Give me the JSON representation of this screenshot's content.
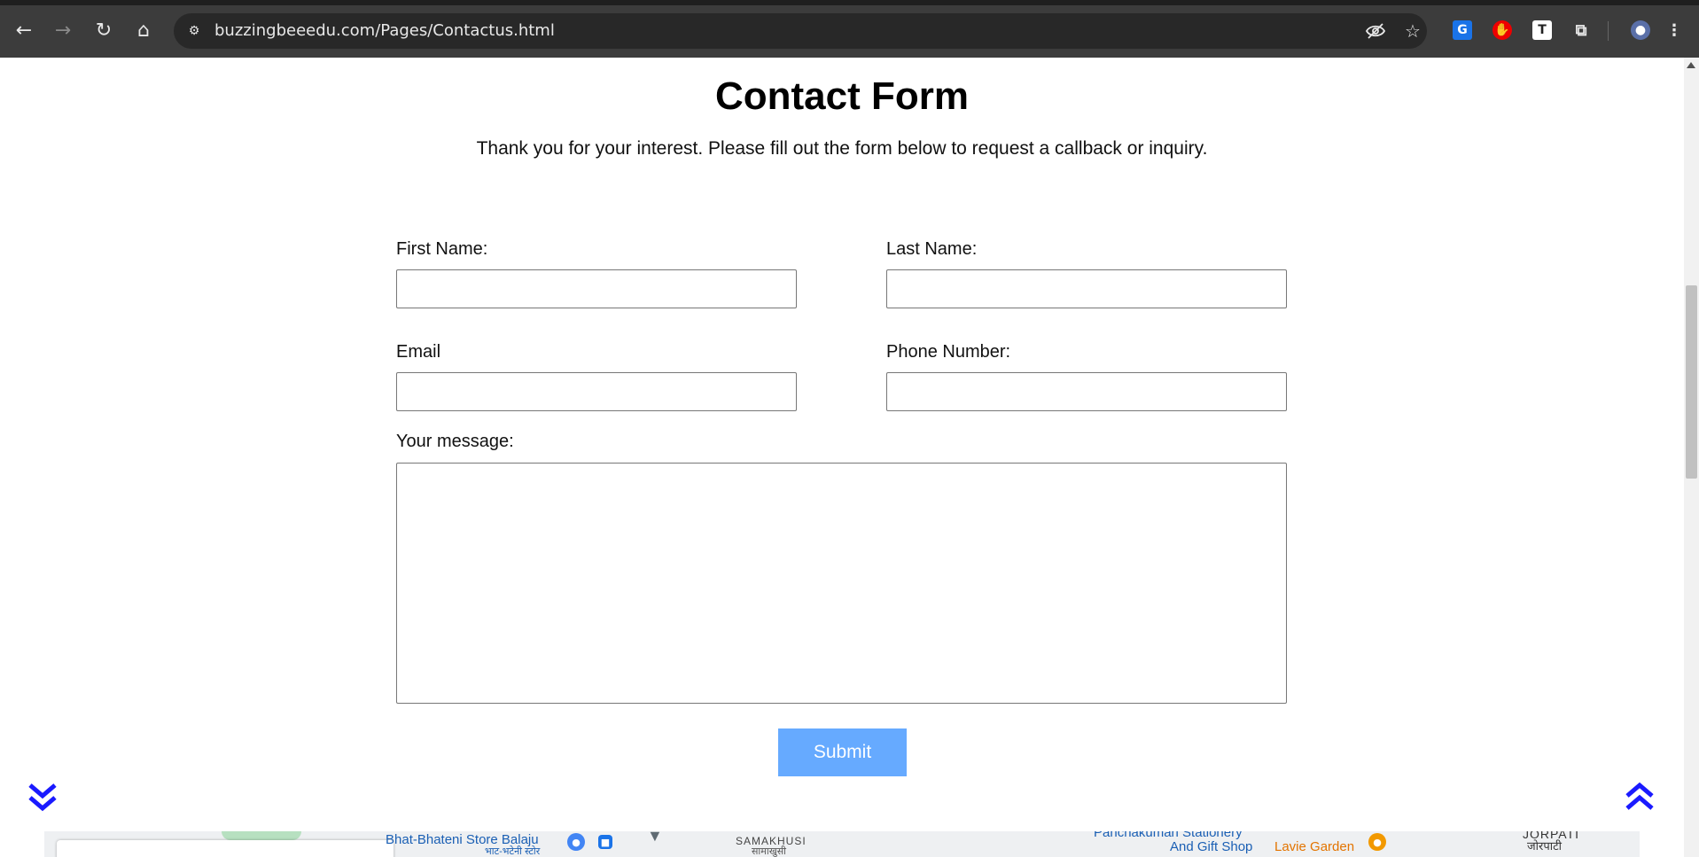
{
  "browser": {
    "url": "buzzingbeeedu.com/Pages/Contactus.html"
  },
  "page": {
    "title": "Contact Form",
    "subtitle": "Thank you for your interest. Please fill out the form below to request a callback or inquiry."
  },
  "form": {
    "first_name_label": "First Name:",
    "last_name_label": "Last Name:",
    "email_label": "Email",
    "phone_label": "Phone Number:",
    "message_label": "Your message:",
    "submit_label": "Submit",
    "first_name_value": "",
    "last_name_value": "",
    "email_value": "",
    "phone_value": "",
    "message_value": ""
  },
  "map": {
    "labels": {
      "bhatbhateni": "Bhat-Bhateni Store Balaju",
      "bhatbhateni_np": "भाट-भटेनी स्टोर",
      "samakhusi": "SAMAKHUSI",
      "samakhusi_np": "सामाखुसी",
      "panchakumari_1": "Panchakumari Stationery",
      "panchakumari_2": "And Gift Shop",
      "lavie": "Lavie Garden",
      "jorpati": "JORPATI",
      "jorpati_np": "जोरपाटी"
    }
  },
  "colors": {
    "submit_bg": "#66aaff",
    "chevron": "#1a1aff",
    "chrome_bg": "#3c3c3c"
  }
}
